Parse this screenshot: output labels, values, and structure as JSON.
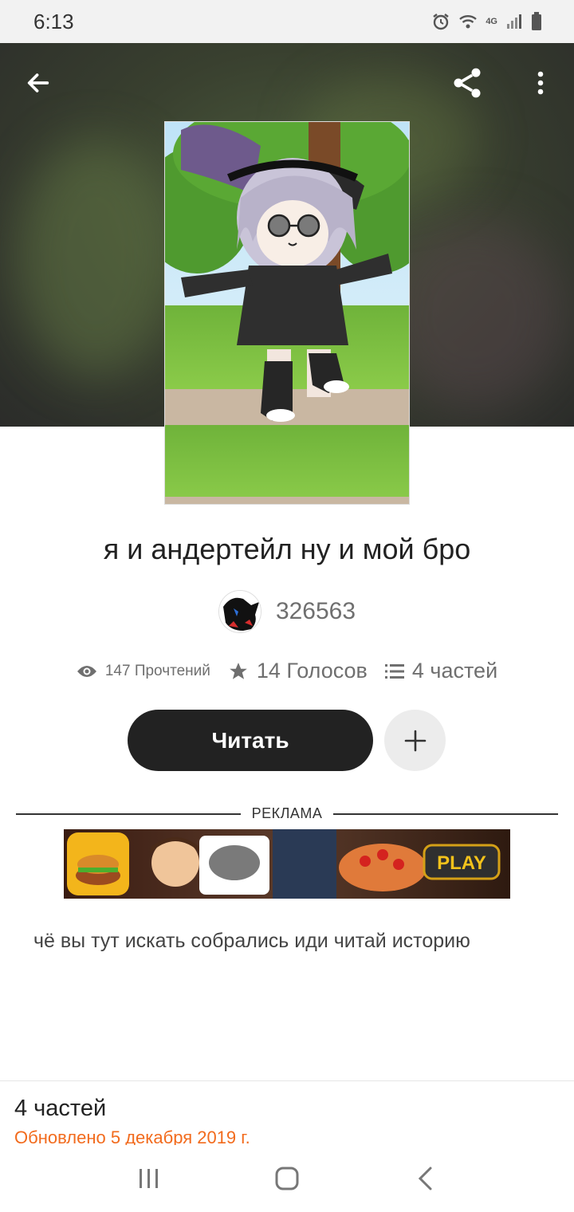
{
  "status_bar": {
    "time": "6:13",
    "network": "4G"
  },
  "story": {
    "title": "я и андертейл ну и мой бро",
    "author": "326563",
    "description": "чё вы тут искать собрались иди читай историю"
  },
  "stats": {
    "reads": "147 Прочтений",
    "votes": "14 Голосов",
    "parts": "4 частей"
  },
  "actions": {
    "read_label": "Читать",
    "add_icon": "plus-icon"
  },
  "ad": {
    "label": "РЕКЛАМА",
    "banner_text": "PLAY"
  },
  "parts_section": {
    "count_label": "4 частей",
    "updated_label": "Обновлено 5 декабря 2019 г."
  },
  "colors": {
    "accent_orange": "#f26b1d",
    "button_dark": "#222222"
  },
  "icons": [
    "back-arrow-icon",
    "share-icon",
    "more-vert-icon",
    "eye-icon",
    "star-icon",
    "list-icon",
    "plus-icon",
    "recents-icon",
    "home-icon",
    "back-icon"
  ]
}
